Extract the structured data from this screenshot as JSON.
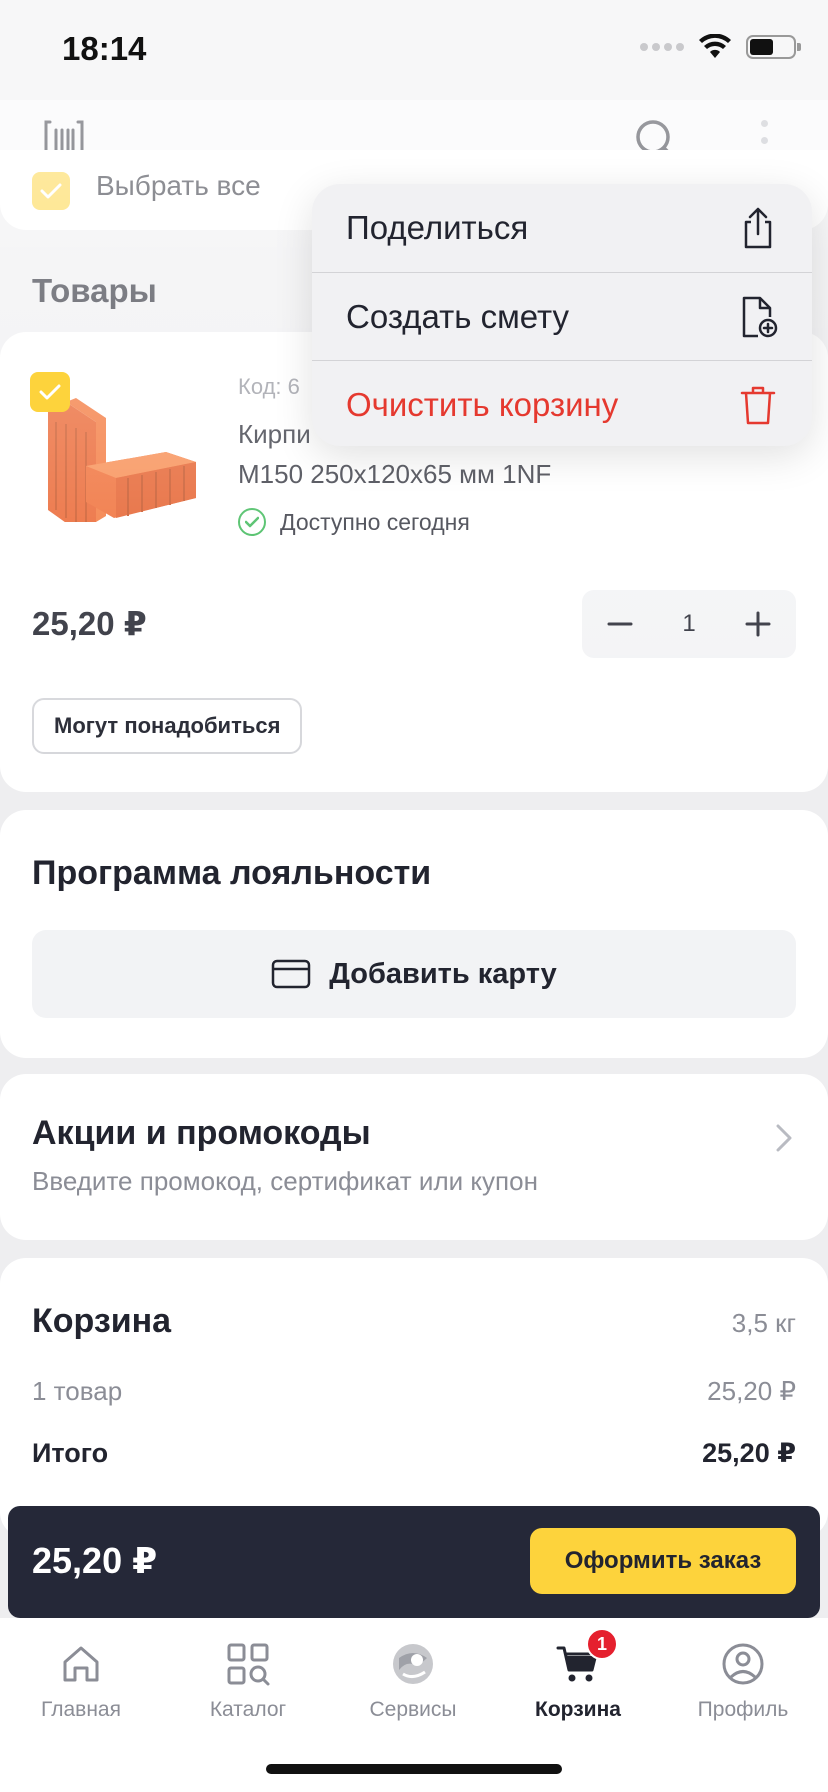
{
  "status_bar": {
    "time": "18:14"
  },
  "select_all": {
    "label": "Выбрать все"
  },
  "goods_section": {
    "title": "Товары"
  },
  "product": {
    "code": "Код: 6",
    "name_line1": "Кирпи",
    "name_line2": "М150 250х120х65 мм 1NF",
    "availability": "Доступно сегодня",
    "price": "25,20 ₽",
    "quantity": "1",
    "related_button": "Могут понадобиться"
  },
  "context_menu": {
    "items": [
      {
        "label": "Поделиться",
        "icon": "share-icon"
      },
      {
        "label": "Создать смету",
        "icon": "document-add-icon"
      },
      {
        "label": "Очистить корзину",
        "icon": "trash-icon"
      }
    ]
  },
  "loyalty": {
    "title": "Программа лояльности",
    "add_card_label": "Добавить карту"
  },
  "promo": {
    "title": "Акции и промокоды",
    "subtitle": "Введите промокод, сертификат или купон"
  },
  "summary": {
    "title": "Корзина",
    "weight": "3,5 кг",
    "count_label": "1 товар",
    "subtotal": "25,20 ₽",
    "total_label": "Итого",
    "total": "25,20 ₽"
  },
  "checkout": {
    "total": "25,20 ₽",
    "button_label": "Оформить заказ"
  },
  "tab_bar": {
    "items": [
      {
        "label": "Главная",
        "icon": "home-icon"
      },
      {
        "label": "Каталог",
        "icon": "catalog-icon"
      },
      {
        "label": "Сервисы",
        "icon": "services-icon"
      },
      {
        "label": "Корзина",
        "icon": "cart-icon",
        "badge": "1"
      },
      {
        "label": "Профиль",
        "icon": "profile-icon"
      }
    ]
  },
  "colors": {
    "accent": "#fdd33c",
    "dark": "#252838",
    "danger": "#e5392f",
    "success": "#2cb34a",
    "badge": "#e5202e"
  }
}
